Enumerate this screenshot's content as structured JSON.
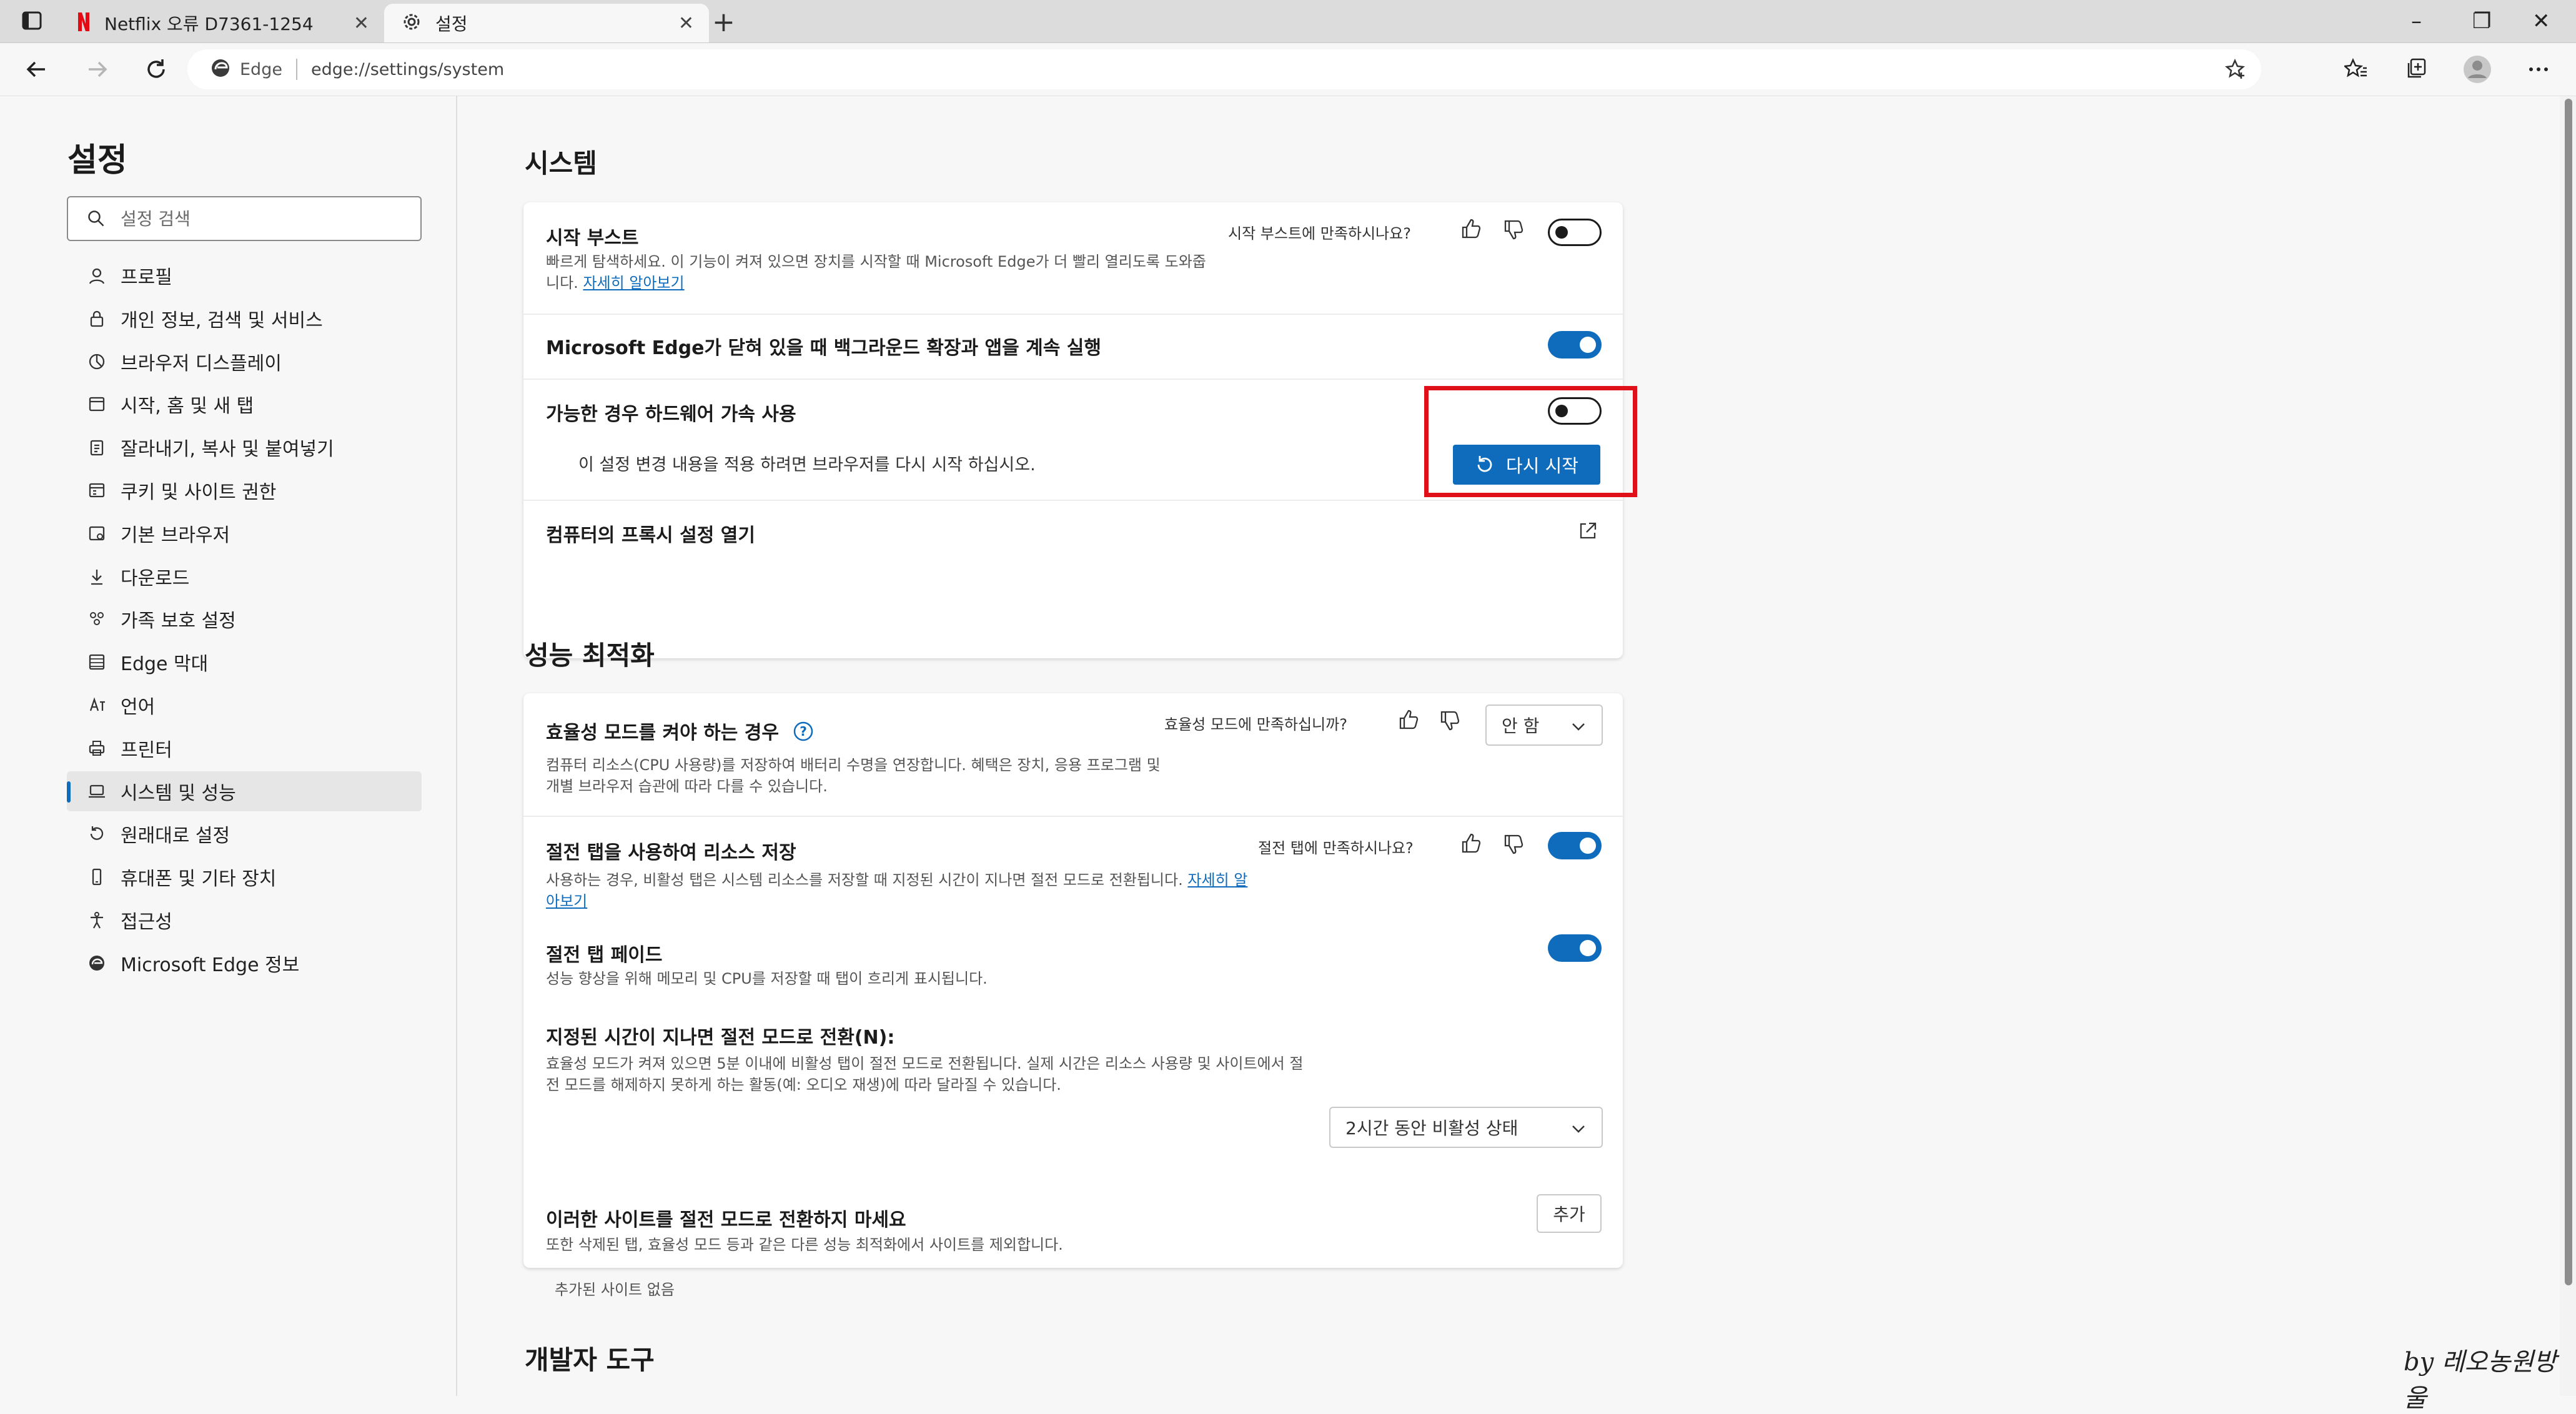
{
  "browser": {
    "tabs": [
      {
        "title": "Netflix 오류 D7361-1254",
        "icon": "netflix-icon"
      },
      {
        "title": "설정",
        "icon": "gear-icon"
      }
    ],
    "new_tab_label": "+",
    "omnibox": {
      "site_label": "Edge",
      "url": "edge://settings/system"
    },
    "window_controls": {
      "minimize": "–",
      "restore": "❐",
      "close": "✕"
    },
    "toolbar_icons": [
      "back-icon",
      "forward-icon",
      "refresh-icon",
      "favorites-star-icon",
      "favorites-list-icon",
      "collections-icon",
      "profile-icon",
      "more-icon"
    ]
  },
  "sidebar": {
    "title": "설정",
    "search_placeholder": "설정 검색",
    "items": [
      {
        "label": "프로필",
        "icon": "profile-icon"
      },
      {
        "label": "개인 정보, 검색 및 서비스",
        "icon": "lock-icon"
      },
      {
        "label": "브라우저 디스플레이",
        "icon": "display-icon"
      },
      {
        "label": "시작, 홈 및 새 탭",
        "icon": "home-icon"
      },
      {
        "label": "잘라내기, 복사 및 붙여넣기",
        "icon": "clipboard-icon"
      },
      {
        "label": "쿠키 및 사이트 권한",
        "icon": "cookie-icon"
      },
      {
        "label": "기본 브라우저",
        "icon": "browser-icon"
      },
      {
        "label": "다운로드",
        "icon": "download-icon"
      },
      {
        "label": "가족 보호 설정",
        "icon": "family-icon"
      },
      {
        "label": "Edge 막대",
        "icon": "edge-bar-icon"
      },
      {
        "label": "언어",
        "icon": "language-icon"
      },
      {
        "label": "프린터",
        "icon": "printer-icon"
      },
      {
        "label": "시스템 및 성능",
        "icon": "laptop-icon",
        "active": true
      },
      {
        "label": "원래대로 설정",
        "icon": "reset-icon"
      },
      {
        "label": "휴대폰 및 기타 장치",
        "icon": "phone-icon"
      },
      {
        "label": "접근성",
        "icon": "accessibility-icon"
      },
      {
        "label": "Microsoft Edge 정보",
        "icon": "edge-logo-icon"
      }
    ]
  },
  "system": {
    "title": "시스템",
    "startup_boost": {
      "title": "시작 부스트",
      "desc": "빠르게 탐색하세요. 이 기능이 켜져 있으면 장치를 시작할 때 Microsoft Edge가 더 빨리 열리도록 도와줍니다.",
      "link": "자세히 알아보기",
      "feedback": "시작 부스트에 만족하시나요?",
      "enabled": false
    },
    "background": {
      "title": "Microsoft Edge가 닫혀 있을 때 백그라운드 확장과 앱을 계속 실행",
      "enabled": true
    },
    "hardware_accel": {
      "title": "가능한 경우 하드웨어 가속 사용",
      "notice": "이 설정 변경 내용을 적용 하려면 브라우저를 다시 시작 하십시오.",
      "restart_label": "다시 시작",
      "enabled": false
    },
    "proxy": {
      "title": "컴퓨터의 프록시 설정 열기"
    }
  },
  "performance": {
    "title": "성능 최적화",
    "efficiency": {
      "title": "효율성 모드를 켜야 하는 경우",
      "desc": "컴퓨터 리소스(CPU 사용량)를 저장하여 배터리 수명을 연장합니다. 혜택은 장치, 응용 프로그램 및 개별 브라우저 습관에 따라 다를 수 있습니다.",
      "feedback": "효율성 모드에 만족하십니까?",
      "value": "안 함"
    },
    "sleeping_tabs": {
      "title": "절전 탭을 사용하여 리소스 저장",
      "desc": "사용하는 경우, 비활성 탭은 시스템 리소스를 저장할 때 지정된 시간이 지나면 절전 모드로 전환됩니다.",
      "link": "자세히 알아보기",
      "feedback": "절전 탭에 만족하시나요?",
      "enabled": true
    },
    "fade": {
      "title": "절전 탭 페이드",
      "desc": "성능 향상을 위해 메모리 및 CPU를 저장할 때 탭이 흐리게 표시됩니다.",
      "enabled": true
    },
    "timeout": {
      "title": "지정된 시간이 지나면 절전 모드로 전환(N):",
      "desc": "효율성 모드가 켜져 있으면 5분 이내에 비활성 탭이 절전 모드로 전환됩니다. 실제 시간은 리소스 사용량 및 사이트에서 절전 모드를 해제하지 못하게 하는 활동(예: 오디오 재생)에 따라 달라질 수 있습니다.",
      "value": "2시간 동안 비활성 상태"
    },
    "never_sleep": {
      "title": "이러한 사이트를 절전 모드로 전환하지 마세요",
      "desc": "또한 삭제된 탭, 효율성 모드 등과 같은 다른 성능 최적화에서 사이트를 제외합니다.",
      "add_label": "추가",
      "empty": "추가된 사이트 없음"
    }
  },
  "devtools": {
    "title": "개발자 도구"
  },
  "watermark": "by 레오농원방울",
  "colors": {
    "accent": "#0f6cbd",
    "highlight": "#e0101a"
  }
}
